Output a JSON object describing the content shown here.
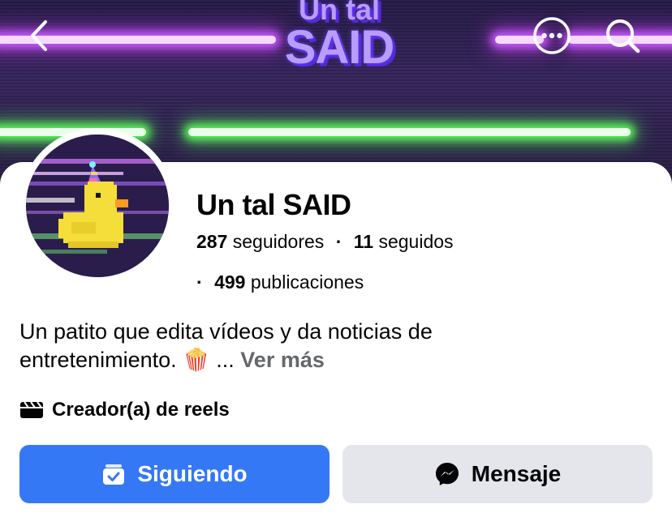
{
  "cover": {
    "logo_line1": "Un tal",
    "logo_line2": "SAID"
  },
  "nav": {
    "back_icon": "chevron-left-icon",
    "more_icon": "more-horizontal-icon",
    "search_icon": "search-icon"
  },
  "profile": {
    "name": "Un tal SAID",
    "followers_count": "287",
    "followers_label": "seguidores",
    "following_count": "11",
    "following_label": "seguidos",
    "posts_count": "499",
    "posts_label": "publicaciones",
    "separator": "·"
  },
  "bio": {
    "text": "Un patito que edita vídeos y da noticias de entretenimiento. 🍿",
    "ellipsis": "...",
    "see_more": "Ver más"
  },
  "category": {
    "icon": "clapperboard-icon",
    "label": "Creador(a) de reels"
  },
  "actions": {
    "follow_label": "Siguiendo",
    "follow_icon": "following-check-icon",
    "message_label": "Mensaje",
    "message_icon": "messenger-icon"
  },
  "colors": {
    "primary": "#3578f5",
    "secondary_button": "#e4e6eb",
    "muted_text": "#65676b"
  }
}
